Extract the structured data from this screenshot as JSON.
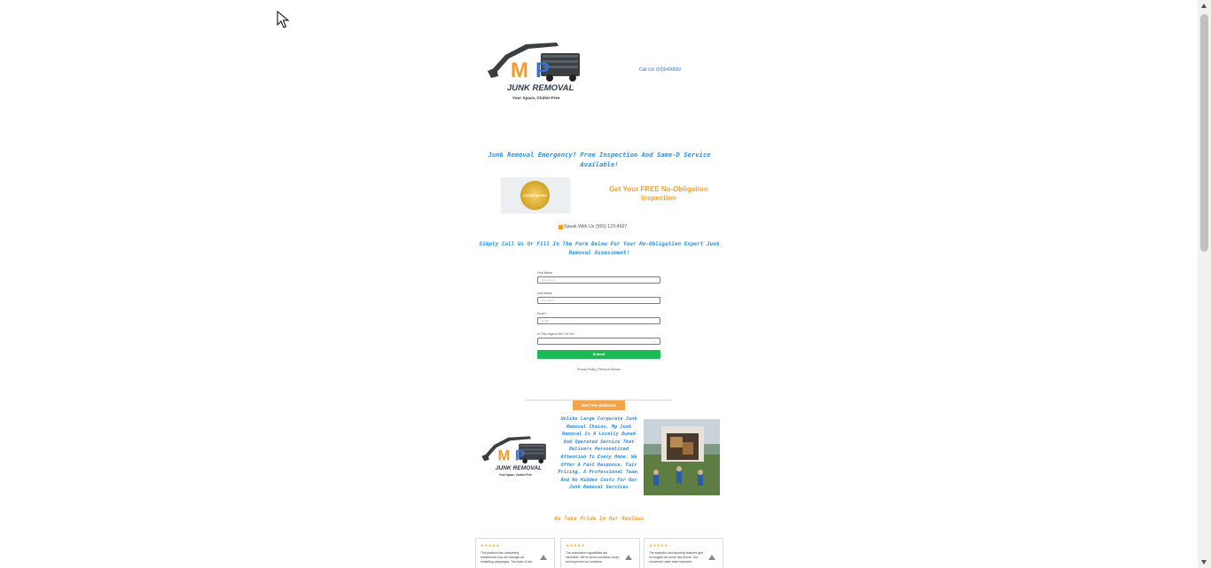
{
  "header": {
    "logo_alt": "MP Junk Removal - Your Space, Clutter-Free",
    "logo_name": "JUNK REMOVAL",
    "logo_tagline": "Your Space, Clutter-Free",
    "call_us": "Call Us! (02)6420932"
  },
  "hero": {
    "headline": "Junk Removal Emergency? Free Inspection And Same-D Service Available!",
    "badge_text": "5 STAR RATING",
    "free_offer": "Get Your FREE No-Obligation Inspection",
    "speak": "Speak With Us (555) 123-4567",
    "subhead": "Simply Call Us Or Fill In The Form Below For Your No-Obligation Expert Junk Removal Assessment!"
  },
  "form": {
    "first_name_label": "First Name",
    "first_name_placeholder": "First Name",
    "last_name_label": "Last Name",
    "last_name_placeholder": "Last Name",
    "email_label": "Email *",
    "email_placeholder": "Email",
    "select_label": "Is This Urgent Yes? Or No?",
    "select_value": "",
    "submit_label": "Submit",
    "policy": "Privacy Policy | Terms of Service"
  },
  "cta": {
    "label": "Get Free Estimate"
  },
  "about": {
    "text": "Unlike Large Corporate Junk Removal Chains, Mp Junk Removal Is A Locally Owned And Operated Service That Delivers Personalized Attention To Every Home. We Offer A Fast Response, Fair Pricing, A Professional Team, And No Hidden Costs For Our Junk Removal Services"
  },
  "reviews": {
    "title": "We Take Pride In Our Reviews",
    "items": [
      {
        "stars": "★★★★★",
        "text": "This platform has completely transformed how we manage our marketing campaigns. The ease of use"
      },
      {
        "stars": "★★★★★",
        "text": "The automation capabilities are incredible. We've saved countless hours and improved our customer"
      },
      {
        "stars": "★★★★★",
        "text": "The analytics and reporting features give us insights we never had before. Our conversion rates have improved"
      }
    ]
  },
  "colors": {
    "accent_blue": "#2d8fe6",
    "accent_orange": "#f0a238",
    "submit_green": "#1db954"
  }
}
